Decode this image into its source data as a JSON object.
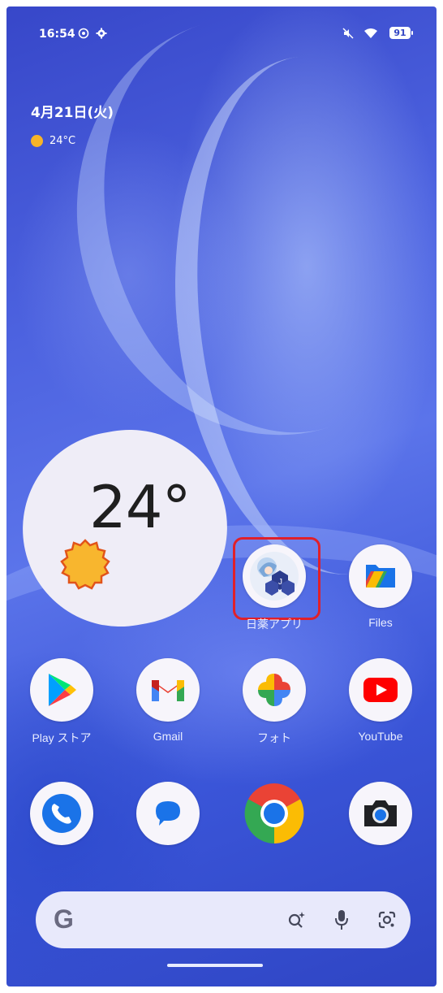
{
  "status_bar": {
    "time": "16:54",
    "battery": "91",
    "icons": [
      "settings-circle-icon",
      "gear-icon",
      "mute-icon",
      "wifi-icon"
    ]
  },
  "date_widget": {
    "date": "4月21日(火)",
    "temperature": "24°C"
  },
  "weather_widget": {
    "temperature": "24°"
  },
  "apps": {
    "row1": [
      {
        "label": "日薬アプリ",
        "icon": "nichiyaku-app-icon",
        "highlighted": true
      },
      {
        "label": "Files",
        "icon": "files-icon"
      }
    ],
    "row2": [
      {
        "label": "Play ストア",
        "icon": "play-store-icon"
      },
      {
        "label": "Gmail",
        "icon": "gmail-icon"
      },
      {
        "label": "フォト",
        "icon": "photos-icon"
      },
      {
        "label": "YouTube",
        "icon": "youtube-icon"
      }
    ],
    "dock": [
      {
        "icon": "phone-icon"
      },
      {
        "icon": "messages-icon"
      },
      {
        "icon": "chrome-icon"
      },
      {
        "icon": "camera-icon"
      }
    ]
  },
  "search_bar": {
    "logo": "G",
    "icons": [
      "ai-search-icon",
      "microphone-icon",
      "lens-icon"
    ]
  },
  "colors": {
    "highlight": "#e0202a",
    "wallpaper": "#4d63e0",
    "sun": "#f7b428"
  }
}
